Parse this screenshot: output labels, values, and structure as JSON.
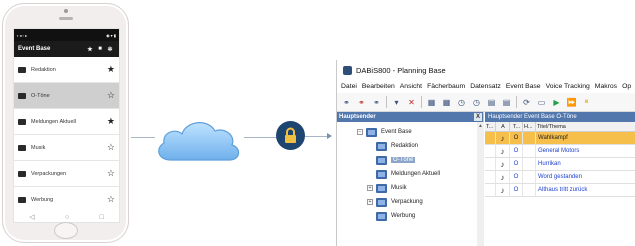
{
  "mobile": {
    "appbar_title": "Event Base",
    "items": [
      {
        "label": "Redaktion",
        "starred": true
      },
      {
        "label": "O-Töne",
        "starred": false
      },
      {
        "label": "Meldungen Aktuell",
        "starred": true
      },
      {
        "label": "Musik",
        "starred": false
      },
      {
        "label": "Verpackungen",
        "starred": false
      },
      {
        "label": "Werbung",
        "starred": false
      }
    ],
    "selected_item": "O-Töne",
    "nav": {
      "back": "◁",
      "home": "○",
      "recent": "□"
    }
  },
  "desktop": {
    "window_title": "DABiS800 - Planning Base",
    "menu": [
      "Datei",
      "Bearbeiten",
      "Ansicht",
      "Fächerbaum",
      "Datensatz",
      "Event Base",
      "Voice Tracking",
      "Makros",
      "Op"
    ],
    "left_panel": {
      "title": "Hauptsender",
      "close": "X",
      "tree": [
        {
          "label": "Event Base",
          "level": 0,
          "expander": "−"
        },
        {
          "label": "Redaktion",
          "level": 1,
          "expander": ""
        },
        {
          "label": "O-Töne",
          "level": 1,
          "expander": "",
          "selected": true
        },
        {
          "label": "Meldungen Aktuell",
          "level": 1,
          "expander": ""
        },
        {
          "label": "Musik",
          "level": 1,
          "expander": "+"
        },
        {
          "label": "Verpackung",
          "level": 1,
          "expander": "+"
        },
        {
          "label": "Werbung",
          "level": 1,
          "expander": ""
        }
      ]
    },
    "right_panel": {
      "title": "Hauptsender Event Base O-Töne",
      "columns": [
        "T...",
        "A",
        "T...",
        "H...",
        "Titel/Thema"
      ],
      "rows": [
        {
          "type": "♪",
          "h": "O",
          "title": "Wahlkampf",
          "highlighted": true
        },
        {
          "type": "♪",
          "h": "O",
          "title": "General Motors",
          "highlighted": false
        },
        {
          "type": "♪",
          "h": "O",
          "title": "Hurrikan",
          "highlighted": false
        },
        {
          "type": "♪",
          "h": "O",
          "title": "Word gestanden",
          "highlighted": false
        },
        {
          "type": "♪",
          "h": "O",
          "title": "Althaus tritt zurück",
          "highlighted": false
        }
      ]
    }
  }
}
